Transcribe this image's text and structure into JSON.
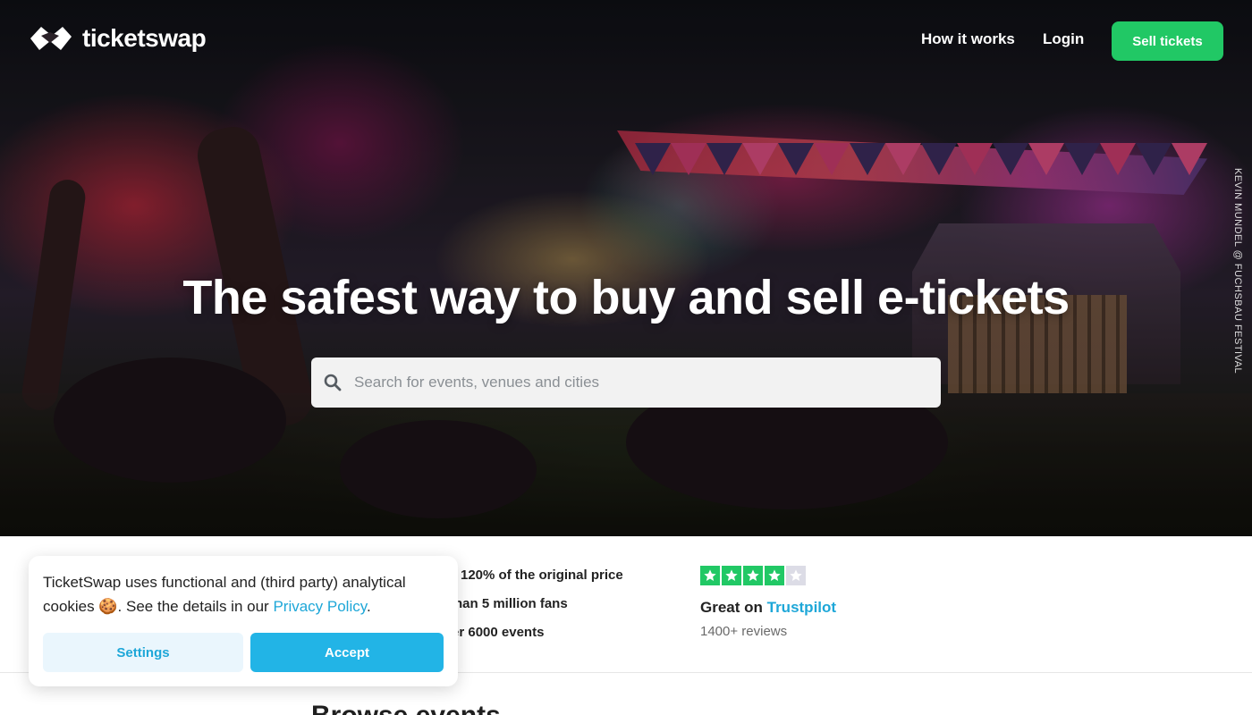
{
  "nav": {
    "logo_text": "ticketswap",
    "how_it_works": "How it works",
    "login": "Login",
    "sell_tickets": "Sell tickets"
  },
  "hero": {
    "headline": "The safest way to buy and sell e-tickets",
    "photo_credit": "KEVIN MUNDEL @ FUCHSBAU FESTIVAL",
    "search_placeholder": "Search for events, venues and cities"
  },
  "stats": {
    "items": [
      "120% of the original price",
      "han 5 million fans",
      "er 6000 events"
    ]
  },
  "trustpilot": {
    "rating": 4,
    "max_rating": 5,
    "great_on": "Great on ",
    "trustpilot_link": "Trustpilot",
    "reviews": "1400+ reviews"
  },
  "browse": {
    "title": "Browse events"
  },
  "cookie": {
    "text_before": "TicketSwap uses functional and (third party) analytical cookies ",
    "emoji": "🍪",
    "text_middle": ". See the details in our ",
    "privacy_link": "Privacy Policy",
    "text_after": ".",
    "settings_label": "Settings",
    "accept_label": "Accept"
  },
  "colors": {
    "brand_green": "#21c865",
    "link_blue": "#1ea7d8",
    "accept_blue": "#22b4e6"
  }
}
